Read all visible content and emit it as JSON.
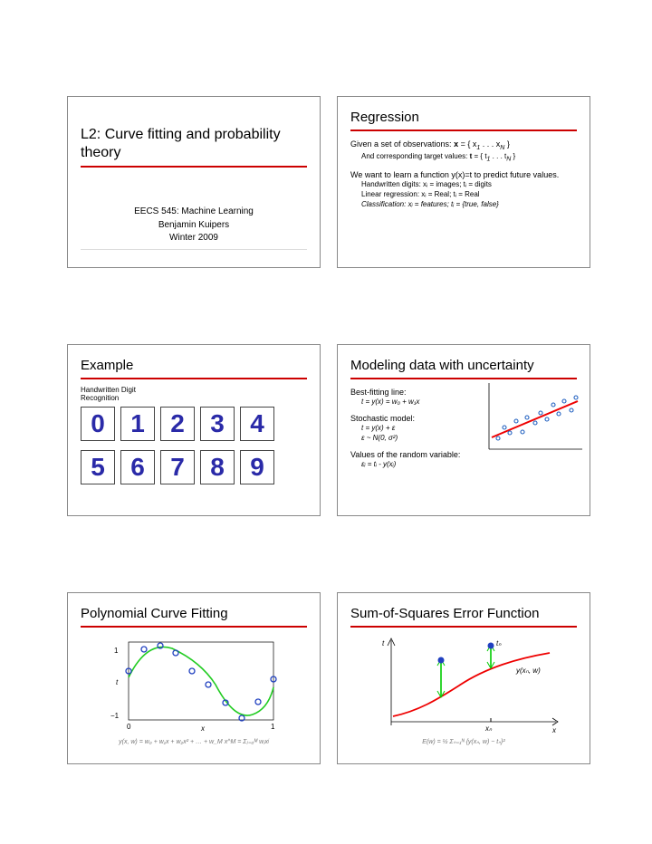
{
  "slide1": {
    "title": "L2:  Curve fitting and probability theory",
    "course": "EECS 545:  Machine Learning",
    "author": "Benjamin Kuipers",
    "term": "Winter 2009"
  },
  "slide2": {
    "title": "Regression",
    "line1_a": "Given a set of observations: ",
    "line1_b": "x",
    "line1_c": " = { x",
    "line1_d": " . . . x",
    "line1_e": " }",
    "sub1": "1",
    "subN": "N",
    "line2_a": "And corresponding target values: ",
    "line2_b": "t",
    "line2_c": " = { t",
    "line2_d": " . . . t",
    "line2_e": " }",
    "line3": "We want to learn a function y(x)=t to predict future values.",
    "b1": "Handwritten digits:  xᵢ = images; tᵢ = digits",
    "b2": "Linear regression:  xᵢ = Real;  tᵢ = Real",
    "b3": "Classification:  xᵢ = features; tᵢ = {true, false}"
  },
  "slide3": {
    "title": "Example",
    "caption": "Handwritten Digit Recognition",
    "row1": [
      "0",
      "1",
      "2",
      "3",
      "4"
    ],
    "row2": [
      "5",
      "6",
      "7",
      "8",
      "9"
    ]
  },
  "slide4": {
    "title": "Modeling data with uncertainty",
    "l1": "Best-fitting line:",
    "eq1": "t = y(x) = w₀ + w₁x",
    "l2": "Stochastic model:",
    "eq2a": "t = y(x) + ε",
    "eq2b": "ε ~ N(0, σ²)",
    "l3": "Values of the random variable:",
    "eq3": "εᵢ = tᵢ - y(xᵢ)"
  },
  "slide5": {
    "title": "Polynomial Curve Fitting",
    "axis_y_top": "t",
    "axis_y_1": "1",
    "axis_y_m1": "−1",
    "axis_x_0": "0",
    "axis_x_1": "1",
    "axis_x_lbl": "x",
    "equation": "y(x, w) = w₀ + w₁x + w₂x² + … + w_M x^M = Σⱼ₌₀ᴹ wⱼxʲ"
  },
  "slide6": {
    "title": "Sum-of-Squares Error Function",
    "lbl_tn": "tₙ",
    "lbl_y": "y(xₙ, w)",
    "lbl_xn": "xₙ",
    "lbl_x": "x",
    "lbl_t": "t",
    "equation": "E(w) = ½ Σₙ₌₁ᴺ {y(xₙ, w) − tₙ}²"
  },
  "chart_data": [
    {
      "type": "scatter_with_line",
      "slide": 4,
      "description": "Scatter of ~15 points with upward red regression line",
      "x_range": [
        0,
        10
      ],
      "y_range": [
        0,
        10
      ],
      "line": {
        "x": [
          0.5,
          9.5
        ],
        "y": [
          2.2,
          7.5
        ],
        "color": "#e00"
      },
      "points": [
        {
          "x": 1.2,
          "y": 2.0
        },
        {
          "x": 1.8,
          "y": 3.6
        },
        {
          "x": 2.3,
          "y": 2.8
        },
        {
          "x": 3.0,
          "y": 4.7
        },
        {
          "x": 3.7,
          "y": 3.0
        },
        {
          "x": 4.1,
          "y": 5.3
        },
        {
          "x": 5.0,
          "y": 4.4
        },
        {
          "x": 5.6,
          "y": 6.0
        },
        {
          "x": 6.2,
          "y": 5.0
        },
        {
          "x": 6.9,
          "y": 7.1
        },
        {
          "x": 7.5,
          "y": 5.8
        },
        {
          "x": 8.0,
          "y": 7.6
        },
        {
          "x": 8.8,
          "y": 6.4
        },
        {
          "x": 9.3,
          "y": 8.0
        }
      ],
      "point_color": "#2060c0"
    },
    {
      "type": "line_with_scatter",
      "slide": 5,
      "description": "Sine-like green curve with ~10 blue circle data points",
      "xlabel": "x",
      "ylabel": "t",
      "xlim": [
        0,
        1
      ],
      "ylim": [
        -1.2,
        1.2
      ],
      "curve_color": "#2c2",
      "curve": [
        {
          "x": 0.0,
          "y": 0.1
        },
        {
          "x": 0.1,
          "y": 0.65
        },
        {
          "x": 0.2,
          "y": 0.98
        },
        {
          "x": 0.3,
          "y": 0.95
        },
        {
          "x": 0.4,
          "y": 0.55
        },
        {
          "x": 0.5,
          "y": 0.0
        },
        {
          "x": 0.6,
          "y": -0.55
        },
        {
          "x": 0.7,
          "y": -0.92
        },
        {
          "x": 0.8,
          "y": -0.95
        },
        {
          "x": 0.9,
          "y": -0.55
        },
        {
          "x": 1.0,
          "y": 0.0
        }
      ],
      "points": [
        {
          "x": 0.0,
          "y": 0.3
        },
        {
          "x": 0.11,
          "y": 0.85
        },
        {
          "x": 0.22,
          "y": 1.0
        },
        {
          "x": 0.33,
          "y": 0.8
        },
        {
          "x": 0.44,
          "y": 0.3
        },
        {
          "x": 0.55,
          "y": -0.1
        },
        {
          "x": 0.67,
          "y": -0.6
        },
        {
          "x": 0.78,
          "y": -1.0
        },
        {
          "x": 0.89,
          "y": -0.55
        },
        {
          "x": 1.0,
          "y": 0.05
        }
      ],
      "point_color": "#2040c0"
    },
    {
      "type": "line_with_error_bars",
      "slide": 6,
      "description": "Red S-curve with two blue points having vertical green error lines to curve",
      "xlabel": "x",
      "ylabel": "t",
      "xlim": [
        0,
        10
      ],
      "ylim": [
        0,
        10
      ],
      "curve_color": "#e00",
      "curve": [
        {
          "x": 0.0,
          "y": 1.0
        },
        {
          "x": 1.5,
          "y": 1.8
        },
        {
          "x": 3.0,
          "y": 3.0
        },
        {
          "x": 4.5,
          "y": 4.8
        },
        {
          "x": 5.5,
          "y": 5.6
        },
        {
          "x": 7.0,
          "y": 6.8
        },
        {
          "x": 8.5,
          "y": 7.6
        },
        {
          "x": 10.0,
          "y": 8.2
        }
      ],
      "points": [
        {
          "x": 3.5,
          "y": 6.5,
          "y_curve": 3.4
        },
        {
          "x": 6.5,
          "y": 9.0,
          "y_curve": 6.4
        }
      ],
      "error_color": "#0c0",
      "point_color": "#2040c0"
    }
  ]
}
